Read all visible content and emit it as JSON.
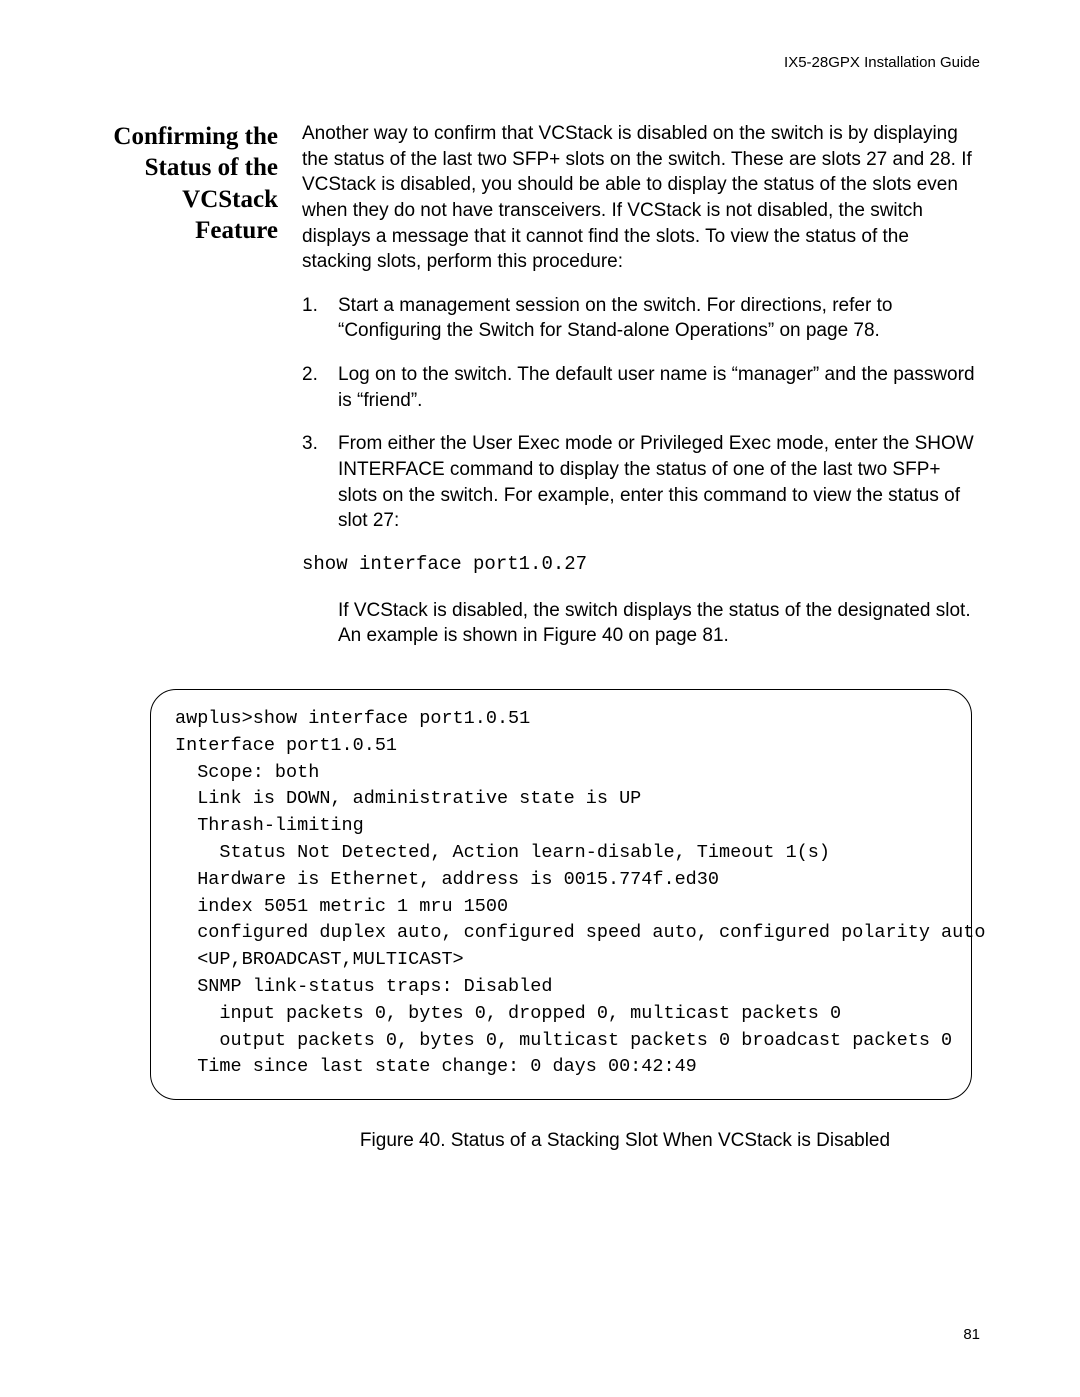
{
  "running_head": "IX5-28GPX Installation Guide",
  "section_heading": "Confirming the Status of the VCStack Feature",
  "intro": "Another way to confirm that VCStack is disabled on the switch is by displaying the status of the last two SFP+ slots on the switch. These are slots 27 and 28. If VCStack is disabled, you should be able to display the status of the slots even when they do not have transceivers. If VCStack is not disabled, the switch displays a message that it cannot find the slots. To view the status of the stacking slots, perform this procedure:",
  "steps": [
    {
      "num": "1.",
      "text": "Start a management session on the switch. For directions, refer to “Configuring the Switch for Stand-alone Operations” on page 78."
    },
    {
      "num": "2.",
      "text": "Log on to the switch. The default user name is “manager” and the password is “friend”."
    },
    {
      "num": "3.",
      "text": "From either the User Exec mode or Privileged Exec mode, enter the SHOW INTERFACE command to display the status of one of the last two SFP+ slots on the switch. For example, enter this command to view the status of slot 27:"
    }
  ],
  "code_line": "show interface port1.0.27",
  "after_code": "If VCStack is disabled, the switch displays the status of the designated slot. An example is shown in Figure 40 on page 81.",
  "terminal_output": "awplus>show interface port1.0.51\nInterface port1.0.51\n  Scope: both\n  Link is DOWN, administrative state is UP\n  Thrash-limiting\n    Status Not Detected, Action learn-disable, Timeout 1(s)\n  Hardware is Ethernet, address is 0015.774f.ed30\n  index 5051 metric 1 mru 1500\n  configured duplex auto, configured speed auto, configured polarity auto\n  <UP,BROADCAST,MULTICAST>\n  SNMP link-status traps: Disabled\n    input packets 0, bytes 0, dropped 0, multicast packets 0\n    output packets 0, bytes 0, multicast packets 0 broadcast packets 0\n  Time since last state change: 0 days 00:42:49",
  "figure_caption": "Figure 40. Status of a Stacking Slot When VCStack is Disabled",
  "page_number": "81"
}
